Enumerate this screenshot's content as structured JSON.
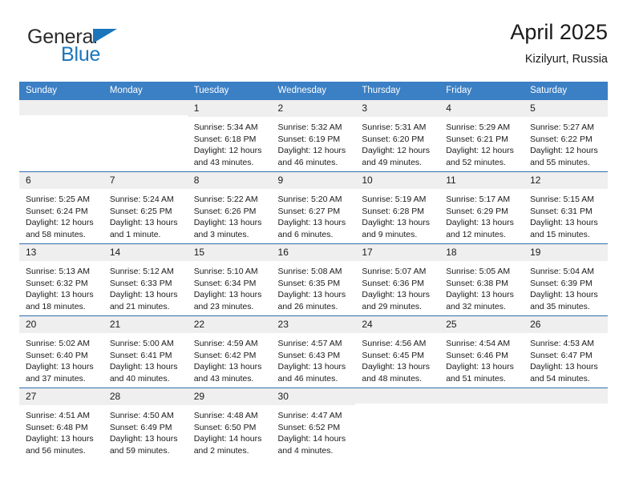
{
  "brand": {
    "name_part1": "General",
    "name_part2": "Blue",
    "flag_icon": "triangle-flag-icon",
    "accent_color": "#1b75bb"
  },
  "header": {
    "title": "April 2025",
    "subtitle": "Kizilyurt, Russia"
  },
  "theme": {
    "header_row_bg": "#3b7fc4",
    "row_divider": "#2f6fae",
    "date_strip_bg": "#efefef",
    "text_color": "#1a1a1a"
  },
  "weekday_headers": [
    "Sunday",
    "Monday",
    "Tuesday",
    "Wednesday",
    "Thursday",
    "Friday",
    "Saturday"
  ],
  "weeks": [
    [
      {
        "day": "",
        "sunrise": "",
        "sunset": "",
        "daylight_line1": "",
        "daylight_line2": "",
        "empty": true
      },
      {
        "day": "",
        "sunrise": "",
        "sunset": "",
        "daylight_line1": "",
        "daylight_line2": "",
        "empty": true
      },
      {
        "day": "1",
        "sunrise": "Sunrise: 5:34 AM",
        "sunset": "Sunset: 6:18 PM",
        "daylight_line1": "Daylight: 12 hours",
        "daylight_line2": "and 43 minutes."
      },
      {
        "day": "2",
        "sunrise": "Sunrise: 5:32 AM",
        "sunset": "Sunset: 6:19 PM",
        "daylight_line1": "Daylight: 12 hours",
        "daylight_line2": "and 46 minutes."
      },
      {
        "day": "3",
        "sunrise": "Sunrise: 5:31 AM",
        "sunset": "Sunset: 6:20 PM",
        "daylight_line1": "Daylight: 12 hours",
        "daylight_line2": "and 49 minutes."
      },
      {
        "day": "4",
        "sunrise": "Sunrise: 5:29 AM",
        "sunset": "Sunset: 6:21 PM",
        "daylight_line1": "Daylight: 12 hours",
        "daylight_line2": "and 52 minutes."
      },
      {
        "day": "5",
        "sunrise": "Sunrise: 5:27 AM",
        "sunset": "Sunset: 6:22 PM",
        "daylight_line1": "Daylight: 12 hours",
        "daylight_line2": "and 55 minutes."
      }
    ],
    [
      {
        "day": "6",
        "sunrise": "Sunrise: 5:25 AM",
        "sunset": "Sunset: 6:24 PM",
        "daylight_line1": "Daylight: 12 hours",
        "daylight_line2": "and 58 minutes."
      },
      {
        "day": "7",
        "sunrise": "Sunrise: 5:24 AM",
        "sunset": "Sunset: 6:25 PM",
        "daylight_line1": "Daylight: 13 hours",
        "daylight_line2": "and 1 minute."
      },
      {
        "day": "8",
        "sunrise": "Sunrise: 5:22 AM",
        "sunset": "Sunset: 6:26 PM",
        "daylight_line1": "Daylight: 13 hours",
        "daylight_line2": "and 3 minutes."
      },
      {
        "day": "9",
        "sunrise": "Sunrise: 5:20 AM",
        "sunset": "Sunset: 6:27 PM",
        "daylight_line1": "Daylight: 13 hours",
        "daylight_line2": "and 6 minutes."
      },
      {
        "day": "10",
        "sunrise": "Sunrise: 5:19 AM",
        "sunset": "Sunset: 6:28 PM",
        "daylight_line1": "Daylight: 13 hours",
        "daylight_line2": "and 9 minutes."
      },
      {
        "day": "11",
        "sunrise": "Sunrise: 5:17 AM",
        "sunset": "Sunset: 6:29 PM",
        "daylight_line1": "Daylight: 13 hours",
        "daylight_line2": "and 12 minutes."
      },
      {
        "day": "12",
        "sunrise": "Sunrise: 5:15 AM",
        "sunset": "Sunset: 6:31 PM",
        "daylight_line1": "Daylight: 13 hours",
        "daylight_line2": "and 15 minutes."
      }
    ],
    [
      {
        "day": "13",
        "sunrise": "Sunrise: 5:13 AM",
        "sunset": "Sunset: 6:32 PM",
        "daylight_line1": "Daylight: 13 hours",
        "daylight_line2": "and 18 minutes."
      },
      {
        "day": "14",
        "sunrise": "Sunrise: 5:12 AM",
        "sunset": "Sunset: 6:33 PM",
        "daylight_line1": "Daylight: 13 hours",
        "daylight_line2": "and 21 minutes."
      },
      {
        "day": "15",
        "sunrise": "Sunrise: 5:10 AM",
        "sunset": "Sunset: 6:34 PM",
        "daylight_line1": "Daylight: 13 hours",
        "daylight_line2": "and 23 minutes."
      },
      {
        "day": "16",
        "sunrise": "Sunrise: 5:08 AM",
        "sunset": "Sunset: 6:35 PM",
        "daylight_line1": "Daylight: 13 hours",
        "daylight_line2": "and 26 minutes."
      },
      {
        "day": "17",
        "sunrise": "Sunrise: 5:07 AM",
        "sunset": "Sunset: 6:36 PM",
        "daylight_line1": "Daylight: 13 hours",
        "daylight_line2": "and 29 minutes."
      },
      {
        "day": "18",
        "sunrise": "Sunrise: 5:05 AM",
        "sunset": "Sunset: 6:38 PM",
        "daylight_line1": "Daylight: 13 hours",
        "daylight_line2": "and 32 minutes."
      },
      {
        "day": "19",
        "sunrise": "Sunrise: 5:04 AM",
        "sunset": "Sunset: 6:39 PM",
        "daylight_line1": "Daylight: 13 hours",
        "daylight_line2": "and 35 minutes."
      }
    ],
    [
      {
        "day": "20",
        "sunrise": "Sunrise: 5:02 AM",
        "sunset": "Sunset: 6:40 PM",
        "daylight_line1": "Daylight: 13 hours",
        "daylight_line2": "and 37 minutes."
      },
      {
        "day": "21",
        "sunrise": "Sunrise: 5:00 AM",
        "sunset": "Sunset: 6:41 PM",
        "daylight_line1": "Daylight: 13 hours",
        "daylight_line2": "and 40 minutes."
      },
      {
        "day": "22",
        "sunrise": "Sunrise: 4:59 AM",
        "sunset": "Sunset: 6:42 PM",
        "daylight_line1": "Daylight: 13 hours",
        "daylight_line2": "and 43 minutes."
      },
      {
        "day": "23",
        "sunrise": "Sunrise: 4:57 AM",
        "sunset": "Sunset: 6:43 PM",
        "daylight_line1": "Daylight: 13 hours",
        "daylight_line2": "and 46 minutes."
      },
      {
        "day": "24",
        "sunrise": "Sunrise: 4:56 AM",
        "sunset": "Sunset: 6:45 PM",
        "daylight_line1": "Daylight: 13 hours",
        "daylight_line2": "and 48 minutes."
      },
      {
        "day": "25",
        "sunrise": "Sunrise: 4:54 AM",
        "sunset": "Sunset: 6:46 PM",
        "daylight_line1": "Daylight: 13 hours",
        "daylight_line2": "and 51 minutes."
      },
      {
        "day": "26",
        "sunrise": "Sunrise: 4:53 AM",
        "sunset": "Sunset: 6:47 PM",
        "daylight_line1": "Daylight: 13 hours",
        "daylight_line2": "and 54 minutes."
      }
    ],
    [
      {
        "day": "27",
        "sunrise": "Sunrise: 4:51 AM",
        "sunset": "Sunset: 6:48 PM",
        "daylight_line1": "Daylight: 13 hours",
        "daylight_line2": "and 56 minutes."
      },
      {
        "day": "28",
        "sunrise": "Sunrise: 4:50 AM",
        "sunset": "Sunset: 6:49 PM",
        "daylight_line1": "Daylight: 13 hours",
        "daylight_line2": "and 59 minutes."
      },
      {
        "day": "29",
        "sunrise": "Sunrise: 4:48 AM",
        "sunset": "Sunset: 6:50 PM",
        "daylight_line1": "Daylight: 14 hours",
        "daylight_line2": "and 2 minutes."
      },
      {
        "day": "30",
        "sunrise": "Sunrise: 4:47 AM",
        "sunset": "Sunset: 6:52 PM",
        "daylight_line1": "Daylight: 14 hours",
        "daylight_line2": "and 4 minutes."
      },
      {
        "day": "",
        "sunrise": "",
        "sunset": "",
        "daylight_line1": "",
        "daylight_line2": "",
        "empty": true
      },
      {
        "day": "",
        "sunrise": "",
        "sunset": "",
        "daylight_line1": "",
        "daylight_line2": "",
        "empty": true
      },
      {
        "day": "",
        "sunrise": "",
        "sunset": "",
        "daylight_line1": "",
        "daylight_line2": "",
        "empty": true
      }
    ]
  ]
}
